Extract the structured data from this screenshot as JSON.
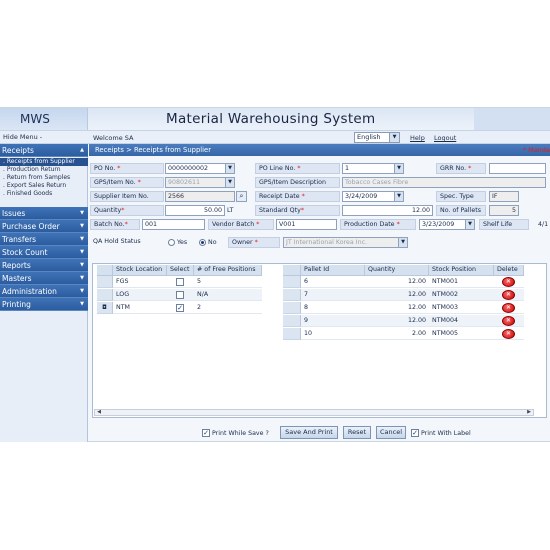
{
  "app": {
    "logo": "MWS",
    "title": "Material Warehousing System"
  },
  "topbar": {
    "hide_menu": "Hide Menu -",
    "welcome": "Welcome SA",
    "language": "English",
    "help": "Help",
    "logout": "Logout"
  },
  "sidebar": {
    "receipts": "Receipts",
    "receipt_items": [
      "Receipts from Supplier",
      "Production Return",
      "Return from Samples",
      "Export Sales Return",
      "Finished Goods"
    ],
    "sections": [
      "Issues",
      "Purchase Order",
      "Transfers",
      "Stock Count",
      "Reports",
      "Masters",
      "Administration",
      "Printing"
    ]
  },
  "breadcrumb": {
    "text": "Receipts > Receipts from Supplier",
    "mandatory": "* Manda"
  },
  "form": {
    "po_no_label": "PO No.",
    "po_no": "0000000002",
    "po_line_label": "PO Line No.",
    "po_line": "1",
    "grr_label": "GRR No.",
    "gps_item_label": "GPS/Item No.",
    "gps_item": "90802611",
    "gps_desc_label": "GPS/Item Description",
    "gps_desc": "Tobacco Cases Fibre",
    "supplier_item_label": "Supplier Item No.",
    "supplier_item": "2566",
    "receipt_date_label": "Receipt Date",
    "receipt_date": "3/24/2009",
    "spec_type_label": "Spec. Type",
    "spec_type": "IF",
    "quantity_label": "Quantity",
    "quantity": "50.00",
    "quantity_unit": "LT",
    "standard_qty_label": "Standard Qty",
    "standard_qty": "12.00",
    "pallets_label": "No. of Pallets",
    "pallets": "5",
    "batch_label": "Batch No.",
    "batch": "001",
    "vendor_batch_label": "Vendor Batch",
    "vendor_batch": "V001",
    "production_date_label": "Production Date",
    "production_date": "3/23/2009",
    "shelf_life_label": "Shelf Life",
    "shelf_life": "4/1",
    "qa_hold_label": "QA Hold Status",
    "yes_label": "Yes",
    "no_label": "No",
    "owner_label": "Owner",
    "owner": "JT International Korea Inc."
  },
  "locations_grid": {
    "headers": [
      "Stock Location",
      "Select",
      "# of Free Positions"
    ],
    "rows": [
      {
        "location": "FGS",
        "selected": false,
        "free": "5"
      },
      {
        "location": "LOG",
        "selected": false,
        "free": "N/A"
      },
      {
        "location": "NTM",
        "selected": true,
        "free": "2"
      }
    ]
  },
  "pallets_grid": {
    "headers": [
      "Pallet Id",
      "Quantity",
      "Stock Position",
      "Delete"
    ],
    "rows": [
      {
        "pallet": "6",
        "qty": "12.00",
        "pos": "NTM001"
      },
      {
        "pallet": "7",
        "qty": "12.00",
        "pos": "NTM002"
      },
      {
        "pallet": "8",
        "qty": "12.00",
        "pos": "NTM003"
      },
      {
        "pallet": "9",
        "qty": "12.00",
        "pos": "NTM004"
      },
      {
        "pallet": "10",
        "qty": "2.00",
        "pos": "NTM005"
      }
    ]
  },
  "bottom": {
    "print_while_save": "Print While Save ?",
    "save_print": "Save And Print",
    "reset": "Reset",
    "cancel": "Cancel",
    "print_label": "Print With Label"
  }
}
